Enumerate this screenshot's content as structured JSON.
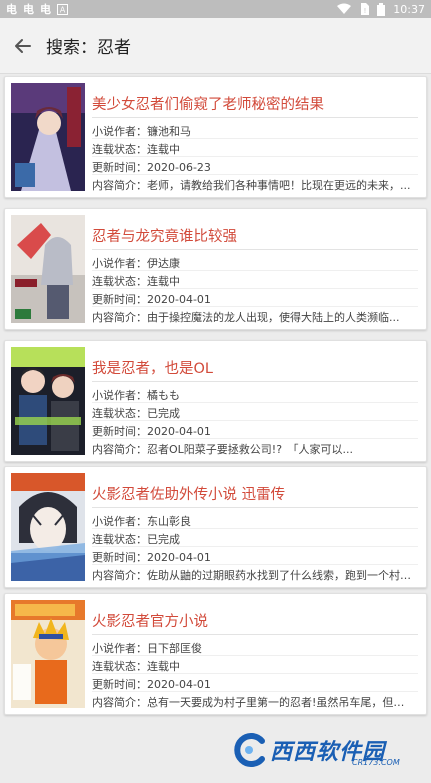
{
  "status_bar": {
    "left_icons": [
      "bird-icon",
      "bird-icon",
      "bird-icon",
      "a-icon"
    ],
    "left_glyphs": [
      "电",
      "电",
      "电"
    ],
    "time": "10:37"
  },
  "toolbar": {
    "title": "搜索：忍者"
  },
  "labels": {
    "author": "小说作者：",
    "status": "连载状态：",
    "updated": "更新时间：",
    "intro": "内容简介："
  },
  "results": [
    {
      "title": "美少女忍者们偷窥了老师秘密的结果",
      "author": "镰池和马",
      "status": "连载中",
      "updated": "2020-06-23",
      "intro": "老师，请教给我们各种事情吧！比现在更远的未来，..."
    },
    {
      "title": "忍者与龙究竟谁比较强",
      "author": "伊达康",
      "status": "连载中",
      "updated": "2020-04-01",
      "intro": "由于操控魔法的龙人出现，使得大陆上的人类濒临..."
    },
    {
      "title": "我是忍者，也是OL",
      "author": "橘もも",
      "status": "已完成",
      "updated": "2020-04-01",
      "intro": "忍者OL阳菜子要拯救公司!?　「人家可以..."
    },
    {
      "title": "火影忍者佐助外传小说 迅雷传",
      "author": "东山彰良",
      "status": "已完成",
      "updated": "2020-04-01",
      "intro": "佐助从鼬的过期眼药水找到了什么线索，跑到一个村子..."
    },
    {
      "title": "火影忍者官方小说",
      "author": "日下部匡俊",
      "status": "连载中",
      "updated": "2020-04-01",
      "intro": "总有一天要成为村子里第一的忍者!虽然吊车尾，但拥..."
    }
  ],
  "watermark": {
    "text": "西西软件园",
    "sub": "CR173.COM"
  },
  "colors": {
    "title_red": "#d24a3a",
    "status_bar": "#bdbdbd",
    "toolbar": "#f2f2f2"
  }
}
